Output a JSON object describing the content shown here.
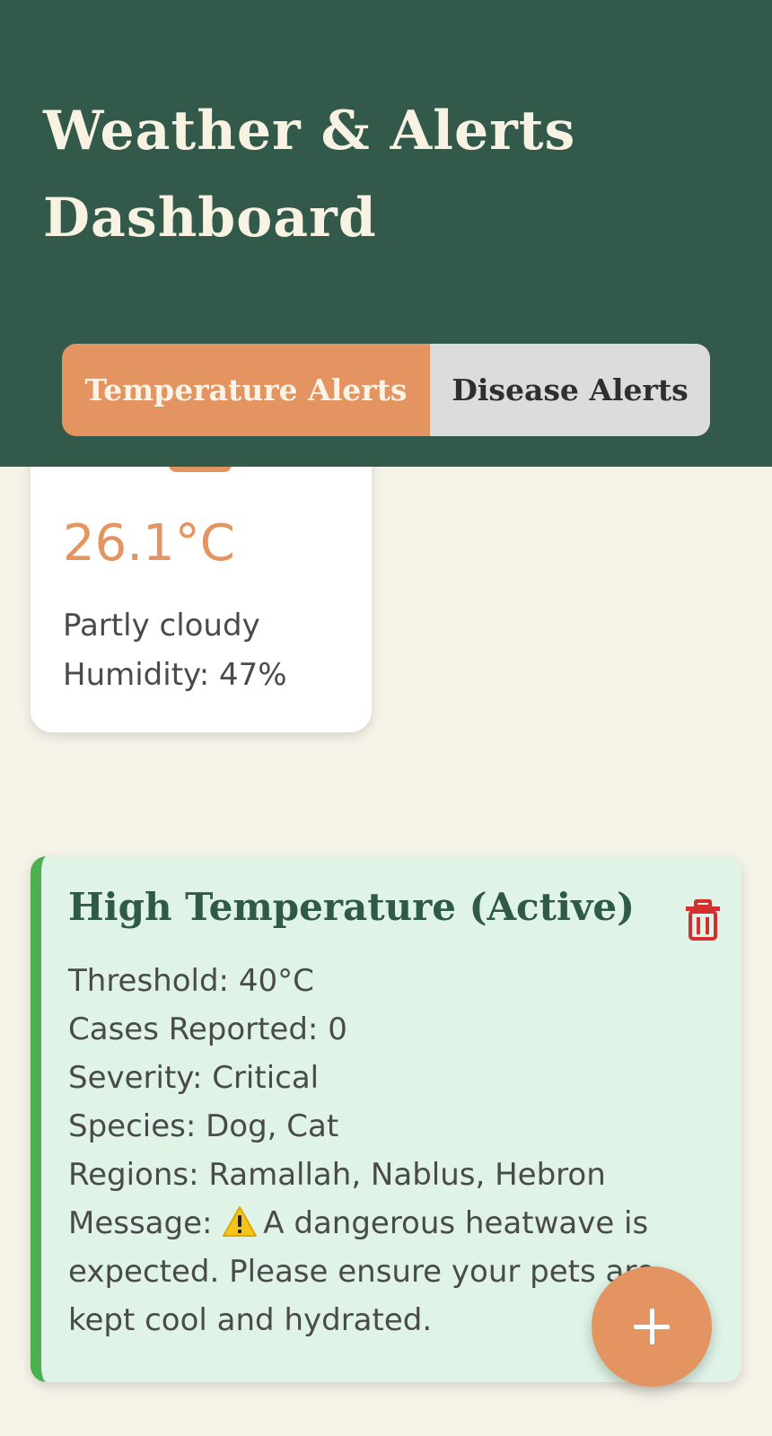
{
  "header": {
    "title": "Weather & Alerts Dashboard"
  },
  "tabs": [
    {
      "label": "Temperature Alerts",
      "active": true
    },
    {
      "label": "Disease Alerts",
      "active": false
    }
  ],
  "weather": {
    "temperature": "26.1°C",
    "description": "Partly cloudy",
    "humidity": "Humidity: 47%"
  },
  "alert": {
    "title": "High Temperature (Active)",
    "status_color": "#4caf50",
    "threshold": "Threshold: 40°C",
    "cases": "Cases Reported: 0",
    "severity": "Severity: Critical",
    "species": "Species: Dog, Cat",
    "regions": "Regions: Ramallah, Nablus, Hebron",
    "message_label": "Message:",
    "message_icon": "warning-icon",
    "message_text": "A dangerous heatwave is expected. Please ensure your pets are kept cool and hydrated.",
    "delete_icon": "trash-icon"
  },
  "fab": {
    "icon": "plus-icon"
  },
  "colors": {
    "header_bg": "#33594a",
    "accent": "#e39461",
    "page_bg": "#f5f2e8",
    "alert_bg": "#dff3e7",
    "delete_red": "#d32f2f"
  }
}
